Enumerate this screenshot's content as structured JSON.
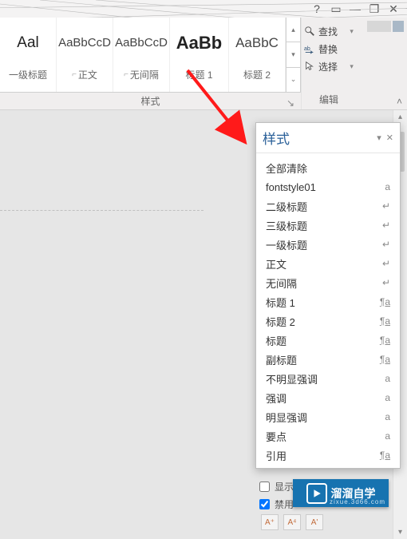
{
  "titlebar": {
    "help": "?",
    "ribbonmin": "▭",
    "min": "—",
    "max": "❐",
    "close": "✕"
  },
  "ribbon": {
    "styles_group_label": "样式",
    "tiles": [
      {
        "preview": "Aal",
        "label": "一级标题",
        "preview_class": "aal"
      },
      {
        "preview": "AaBbCcD",
        "label": "正文"
      },
      {
        "preview": "AaBbCcD",
        "label": "无间隔"
      },
      {
        "preview": "AaBb",
        "label": "标题 1",
        "preview_class": "big"
      },
      {
        "preview": "AaBbC",
        "label": "标题 2"
      }
    ],
    "spin_up": "▴",
    "spin_mid": "▾",
    "spin_more": "⌄",
    "edit": {
      "find": "查找",
      "replace": "替换",
      "select": "选择",
      "group": "编辑"
    },
    "collapse": "˄"
  },
  "styles_pane": {
    "title": "样式",
    "items": [
      {
        "name": "全部清除",
        "mark": ""
      },
      {
        "name": "fontstyle01",
        "mark": "a"
      },
      {
        "name": "二级标题",
        "mark": "↵"
      },
      {
        "name": "三级标题",
        "mark": "↵"
      },
      {
        "name": "一级标题",
        "mark": "↵"
      },
      {
        "name": "正文",
        "mark": "↵"
      },
      {
        "name": "无间隔",
        "mark": "↵"
      },
      {
        "name": "标题 1",
        "mark": "¶a",
        "ul": true
      },
      {
        "name": "标题 2",
        "mark": "¶a",
        "ul": true
      },
      {
        "name": "标题",
        "mark": "¶a",
        "ul": true
      },
      {
        "name": "副标题",
        "mark": "¶a",
        "ul": true
      },
      {
        "name": "不明显强调",
        "mark": "a"
      },
      {
        "name": "强调",
        "mark": "a"
      },
      {
        "name": "明显强调",
        "mark": "a"
      },
      {
        "name": "要点",
        "mark": "a"
      },
      {
        "name": "引用",
        "mark": "¶a",
        "ul": true
      }
    ],
    "options": {
      "show": "显示",
      "disable": "禁用"
    }
  },
  "logo": {
    "text": "溜溜自学",
    "sub": "zixue.3d66.com"
  }
}
